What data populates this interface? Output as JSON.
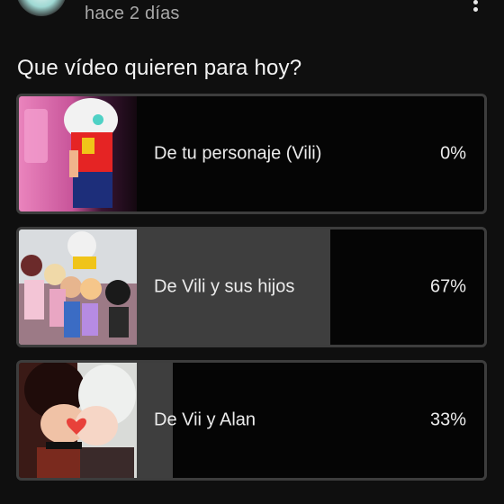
{
  "post": {
    "timestamp": "hace 2 días"
  },
  "poll": {
    "question": "Que vídeo quieren para hoy?",
    "options": [
      {
        "label": "De tu personaje (Vili)",
        "percent_text": "0%",
        "percent": 0
      },
      {
        "label": "De Vili y sus hijos",
        "percent_text": "67%",
        "percent": 67
      },
      {
        "label": "De Vii y Alan",
        "percent_text": "33%",
        "percent": 33
      }
    ]
  },
  "colors": {
    "background": "#0f0f0f",
    "option_border": "#3d3d3d",
    "option_fill": "#3e3e3e",
    "text_primary": "#f1f1f1",
    "text_secondary": "#a8a8a8"
  },
  "icons": {
    "menu": "more-vert-icon",
    "avatar": "channel-avatar"
  }
}
